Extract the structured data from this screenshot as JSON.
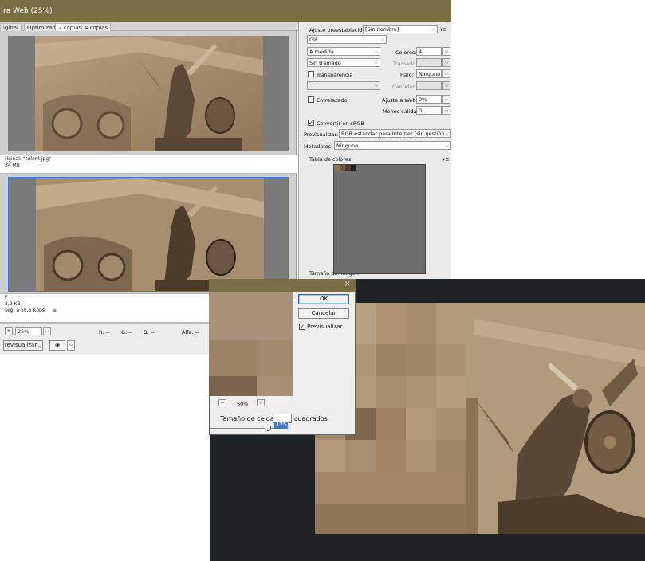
{
  "window": {
    "title": "ra Web (25%)"
  },
  "tabs": [
    {
      "label": "iginal"
    },
    {
      "label": "Optimizado"
    },
    {
      "label": "2 copias"
    },
    {
      "label": "4 copias"
    }
  ],
  "original_info": {
    "line1": "riginal: \"color4.jpg\"",
    "line2": "34 MB"
  },
  "optimized_info": {
    "line1": "F",
    "line2": "3,2 KB",
    "line3": "seg. a 56,6 Kbps",
    "menu_icon": "≡"
  },
  "bottom": {
    "zoom": "25%",
    "r": "R: --",
    "g": "G: --",
    "b": "B: --",
    "alpha": "Alfa: --",
    "preview_label": "revisualizar...",
    "browser_icon": "browser-icon"
  },
  "settings": {
    "preset_label": "Ajuste preestablecido:",
    "preset_value": "[Sin nombre]",
    "format": "GIF",
    "palette": "A medida",
    "colors_label": "Colores:",
    "colors_value": "4",
    "dither": "Sin tramado",
    "dither_amount_label": "Tramado:",
    "transparency_label": "Transparencia",
    "matte_label": "Halo:",
    "matte_value": "Ninguno",
    "amount_label": "Cantidad:",
    "interlaced_label": "Entrelazado",
    "websnap_label": "Ajuste a Web:",
    "websnap_value": "0%",
    "lossy_label": "Menos calidad:",
    "lossy_value": "0",
    "convert_srgb_label": "Convertir en sRGB",
    "preview_label": "Previsualizar:",
    "preview_value": "RGB estándar para Internet (sin gestión ...",
    "metadata_label": "Metadatos:",
    "metadata_value": "Ninguno",
    "color_table_label": "Tabla de colores",
    "color_count": "4",
    "image_size_label": "Tamaño de imagen",
    "swatch_colors": [
      "#8a7458",
      "#6a5540",
      "#4e3c2a",
      "#2a2016"
    ]
  },
  "dialog": {
    "ok": "OK",
    "cancel": "Cancelar",
    "preview_label": "Previsualizar",
    "zoom": "50%",
    "cell_size_label": "Tamaño de celda:",
    "cell_size_value": "125",
    "cell_unit": "cuadrados"
  }
}
